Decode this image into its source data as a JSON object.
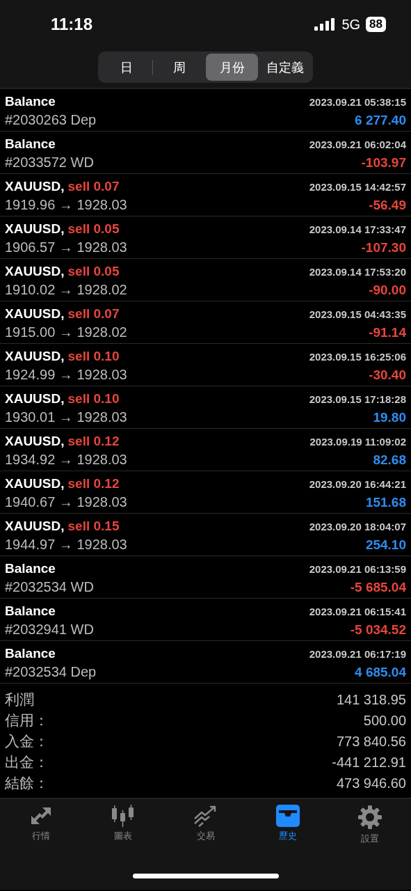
{
  "status_bar": {
    "time": "11:18",
    "network": "5G",
    "battery": "88"
  },
  "period_tabs": [
    {
      "label": "日",
      "selected": false
    },
    {
      "label": "周",
      "selected": false
    },
    {
      "label": "月份",
      "selected": true
    },
    {
      "label": "自定義",
      "selected": false
    }
  ],
  "history": [
    {
      "kind": "balance",
      "title": "Balance",
      "detail": "#2030263 Dep",
      "time": "2023.09.21 05:38:15",
      "amount": "6 277.40",
      "color": "#2f8cf0"
    },
    {
      "kind": "balance",
      "title": "Balance",
      "detail": "#2033572 WD",
      "time": "2023.09.21 06:02:04",
      "amount": "-103.97",
      "color": "#e8453c"
    },
    {
      "kind": "trade",
      "title": "XAUUSD,",
      "side": "sell 0.07",
      "detail": "1919.96 → 1928.03",
      "time": "2023.09.15 14:42:57",
      "amount": "-56.49",
      "color": "#e8453c"
    },
    {
      "kind": "trade",
      "title": "XAUUSD,",
      "side": "sell 0.05",
      "detail": "1906.57 → 1928.03",
      "time": "2023.09.14 17:33:47",
      "amount": "-107.30",
      "color": "#e8453c"
    },
    {
      "kind": "trade",
      "title": "XAUUSD,",
      "side": "sell 0.05",
      "detail": "1910.02 → 1928.02",
      "time": "2023.09.14 17:53:20",
      "amount": "-90.00",
      "color": "#e8453c"
    },
    {
      "kind": "trade",
      "title": "XAUUSD,",
      "side": "sell 0.07",
      "detail": "1915.00 → 1928.02",
      "time": "2023.09.15 04:43:35",
      "amount": "-91.14",
      "color": "#e8453c"
    },
    {
      "kind": "trade",
      "title": "XAUUSD,",
      "side": "sell 0.10",
      "detail": "1924.99 → 1928.03",
      "time": "2023.09.15 16:25:06",
      "amount": "-30.40",
      "color": "#e8453c"
    },
    {
      "kind": "trade",
      "title": "XAUUSD,",
      "side": "sell 0.10",
      "detail": "1930.01 → 1928.03",
      "time": "2023.09.15 17:18:28",
      "amount": "19.80",
      "color": "#2f8cf0"
    },
    {
      "kind": "trade",
      "title": "XAUUSD,",
      "side": "sell 0.12",
      "detail": "1934.92 → 1928.03",
      "time": "2023.09.19 11:09:02",
      "amount": "82.68",
      "color": "#2f8cf0"
    },
    {
      "kind": "trade",
      "title": "XAUUSD,",
      "side": "sell 0.12",
      "detail": "1940.67 → 1928.03",
      "time": "2023.09.20 16:44:21",
      "amount": "151.68",
      "color": "#2f8cf0"
    },
    {
      "kind": "trade",
      "title": "XAUUSD,",
      "side": "sell 0.15",
      "detail": "1944.97 → 1928.03",
      "time": "2023.09.20 18:04:07",
      "amount": "254.10",
      "color": "#2f8cf0"
    },
    {
      "kind": "balance",
      "title": "Balance",
      "detail": "#2032534 WD",
      "time": "2023.09.21 06:13:59",
      "amount": "-5 685.04",
      "color": "#e8453c"
    },
    {
      "kind": "balance",
      "title": "Balance",
      "detail": "#2032941 WD",
      "time": "2023.09.21 06:15:41",
      "amount": "-5 034.52",
      "color": "#e8453c"
    },
    {
      "kind": "balance",
      "title": "Balance",
      "detail": "#2032534 Dep",
      "time": "2023.09.21 06:17:19",
      "amount": "4 685.04",
      "color": "#2f8cf0"
    }
  ],
  "summary": [
    {
      "label": "利潤",
      "value": "141 318.95"
    },
    {
      "label": "信用：",
      "value": "500.00"
    },
    {
      "label": "入金：",
      "value": "773 840.56"
    },
    {
      "label": "出金：",
      "value": "-441 212.91"
    },
    {
      "label": "結餘：",
      "value": "473 946.60"
    }
  ],
  "tab_bar": [
    {
      "kind": "quotes",
      "label": "行情",
      "selected": false
    },
    {
      "kind": "chart",
      "label": "圖表",
      "selected": false
    },
    {
      "kind": "trade",
      "label": "交易",
      "selected": false
    },
    {
      "kind": "history",
      "label": "歷史",
      "selected": true
    },
    {
      "kind": "settings",
      "label": "設置",
      "selected": false
    }
  ]
}
